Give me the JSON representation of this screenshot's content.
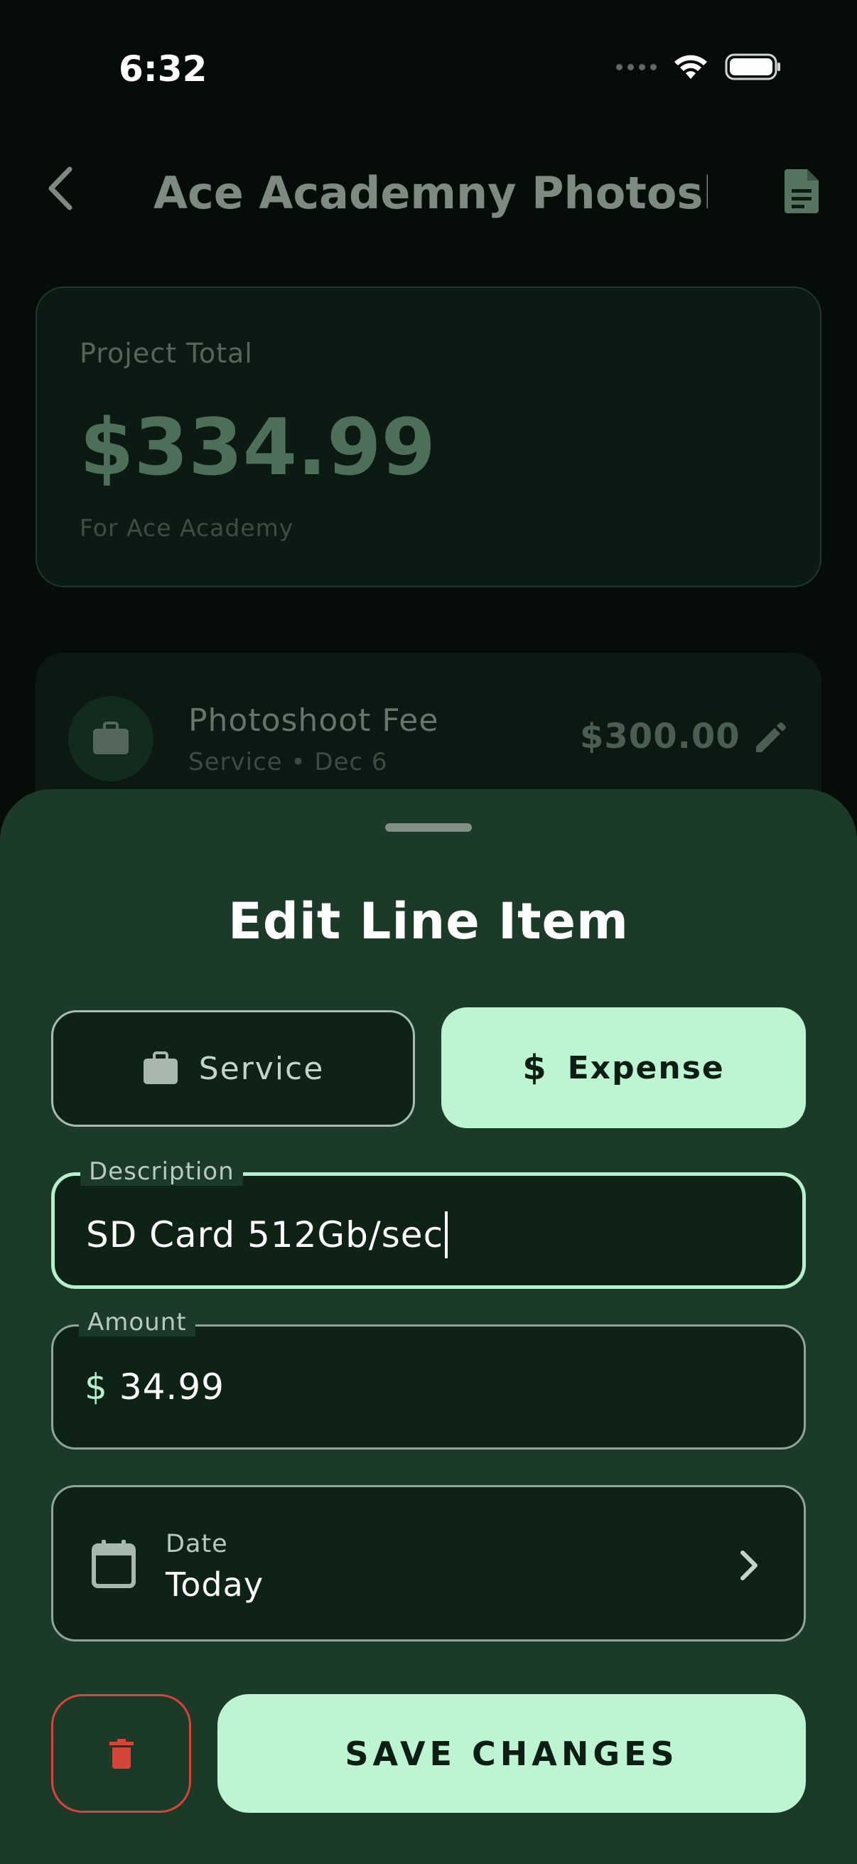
{
  "status_bar": {
    "time": "6:32"
  },
  "nav": {
    "title": "Ace Academny Photosh..."
  },
  "project": {
    "total_label": "Project Total",
    "total_amount": "$334.99",
    "client_line": "For Ace Academy"
  },
  "line_items": [
    {
      "title": "Photoshoot Fee",
      "meta": "Service • Dec 6",
      "amount": "$300.00"
    }
  ],
  "sheet": {
    "title": "Edit Line Item",
    "type_options": {
      "service": "Service",
      "expense": "Expense",
      "selected": "Expense"
    },
    "description": {
      "label": "Description",
      "value": "SD Card 512Gb/sec"
    },
    "amount": {
      "label": "Amount",
      "prefix": "$",
      "value": "34.99"
    },
    "date": {
      "label": "Date",
      "value": "Today"
    },
    "save_label": "SAVE CHANGES"
  },
  "colors": {
    "sheet_bg": "#1b3a28",
    "accent": "#bdf5d2",
    "delete": "#d5453a"
  },
  "icons": [
    "chevron-left-icon",
    "document-icon",
    "briefcase-icon",
    "pencil-icon",
    "dollar-icon",
    "calendar-icon",
    "chevron-right-icon",
    "trash-icon",
    "wifi-icon",
    "battery-icon"
  ]
}
